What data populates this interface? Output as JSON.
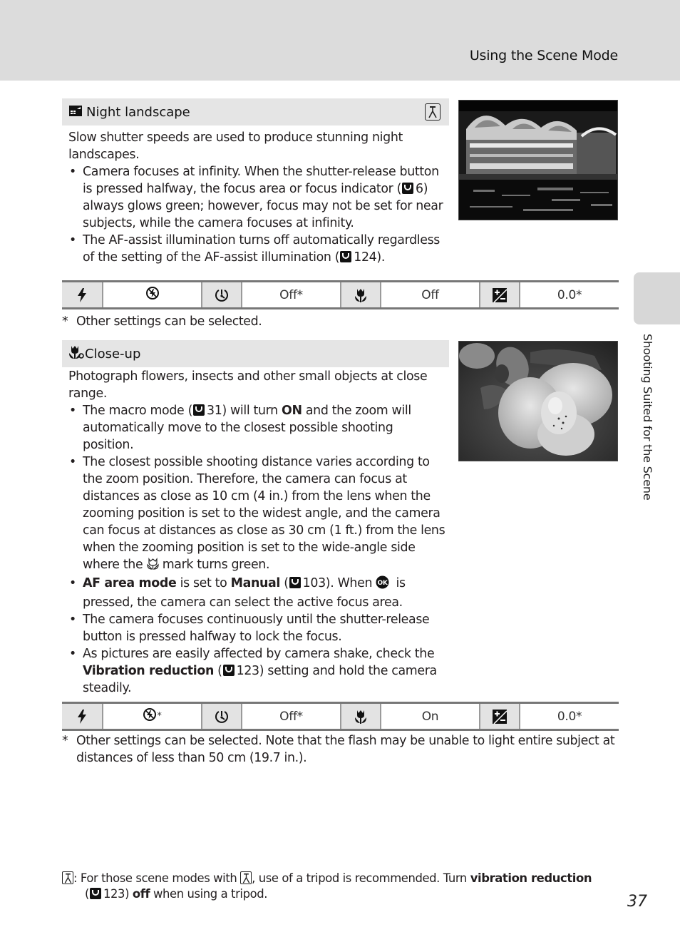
{
  "header": {
    "running_head": "Using the Scene Mode"
  },
  "side_tab": {
    "label": "Shooting Suited for the Scene"
  },
  "sections": [
    {
      "id": "night-landscape",
      "title": "Night landscape",
      "title_icon": "night-landscape-icon",
      "tripod_recommended": true,
      "intro": "Slow shutter speeds are used to produce stunning night landscapes.",
      "bullets": [
        {
          "parts": [
            "Camera focuses at infinity. When the shutter-release button is pressed halfway, the focus area or focus indicator (",
            "6",
            ") always glows green; however, focus may not be set for near subjects, while the camera focuses at infinity."
          ]
        },
        {
          "parts": [
            "The AF-assist illumination turns off automatically regardless of the setting of the AF-assist illumination (",
            "124",
            ")."
          ]
        }
      ],
      "photo_alt": "Night photo of an illuminated riverside building reflected in water",
      "settings": [
        {
          "icon": "flash-mode-icon",
          "value_icon": "flash-off-icon",
          "value": ""
        },
        {
          "icon": "self-timer-icon",
          "value": "Off*"
        },
        {
          "icon": "macro-mode-icon",
          "value": "Off"
        },
        {
          "icon": "exposure-compensation-icon",
          "value": "0.0*"
        }
      ],
      "footnote": "Other settings can be selected."
    },
    {
      "id": "close-up",
      "title": "Close-up",
      "title_icon": "close-up-icon",
      "tripod_recommended": false,
      "intro": "Photograph flowers, insects and other small objects at close range.",
      "bullets": [
        {
          "parts": [
            "The macro mode (",
            "31",
            ") will turn ",
            "ON",
            " and the zoom will automatically move to the closest possible shooting position."
          ]
        },
        {
          "parts": [
            "The closest possible shooting distance varies according to the zoom position. Therefore, the camera can focus at distances as close as 10 cm (4 in.) from the lens when the zooming position is set to the widest angle, and the camera can focus at distances as close as 30 cm (1 ft.) from the lens when the zooming position is set to the wide-angle side where the ",
            " mark turns green."
          ]
        },
        {
          "parts": [
            "AF area mode",
            " is set to ",
            "Manual",
            " (",
            "103",
            "). When ",
            " is pressed, the camera can select the active focus area."
          ]
        },
        {
          "parts": [
            "The camera focuses continuously until the shutter-release button is pressed halfway to lock the focus."
          ]
        },
        {
          "parts": [
            "As pictures are easily affected by camera shake, check the ",
            "Vibration reduction",
            " (",
            "123",
            ") setting and hold the camera steadily."
          ]
        }
      ],
      "photo_alt": "Close-up photo of an orchid flower",
      "settings": [
        {
          "icon": "flash-mode-icon",
          "value_icon": "flash-off-icon",
          "value": "*"
        },
        {
          "icon": "self-timer-icon",
          "value": "Off*"
        },
        {
          "icon": "macro-mode-icon",
          "value": "On"
        },
        {
          "icon": "exposure-compensation-icon",
          "value": "0.0*"
        }
      ],
      "footnote": "Other settings can be selected. Note that the flash may be unable to light entire subject at distances of less than 50 cm (19.7 in.)."
    }
  ],
  "bottom_note": {
    "parts": [
      ": For those scene modes with ",
      ", use of a tripod is recommended. Turn ",
      "vibration reduction",
      "(",
      "123",
      ") ",
      "off",
      " when using a tripod."
    ]
  },
  "footnote_mark": "*",
  "page_number": "37"
}
